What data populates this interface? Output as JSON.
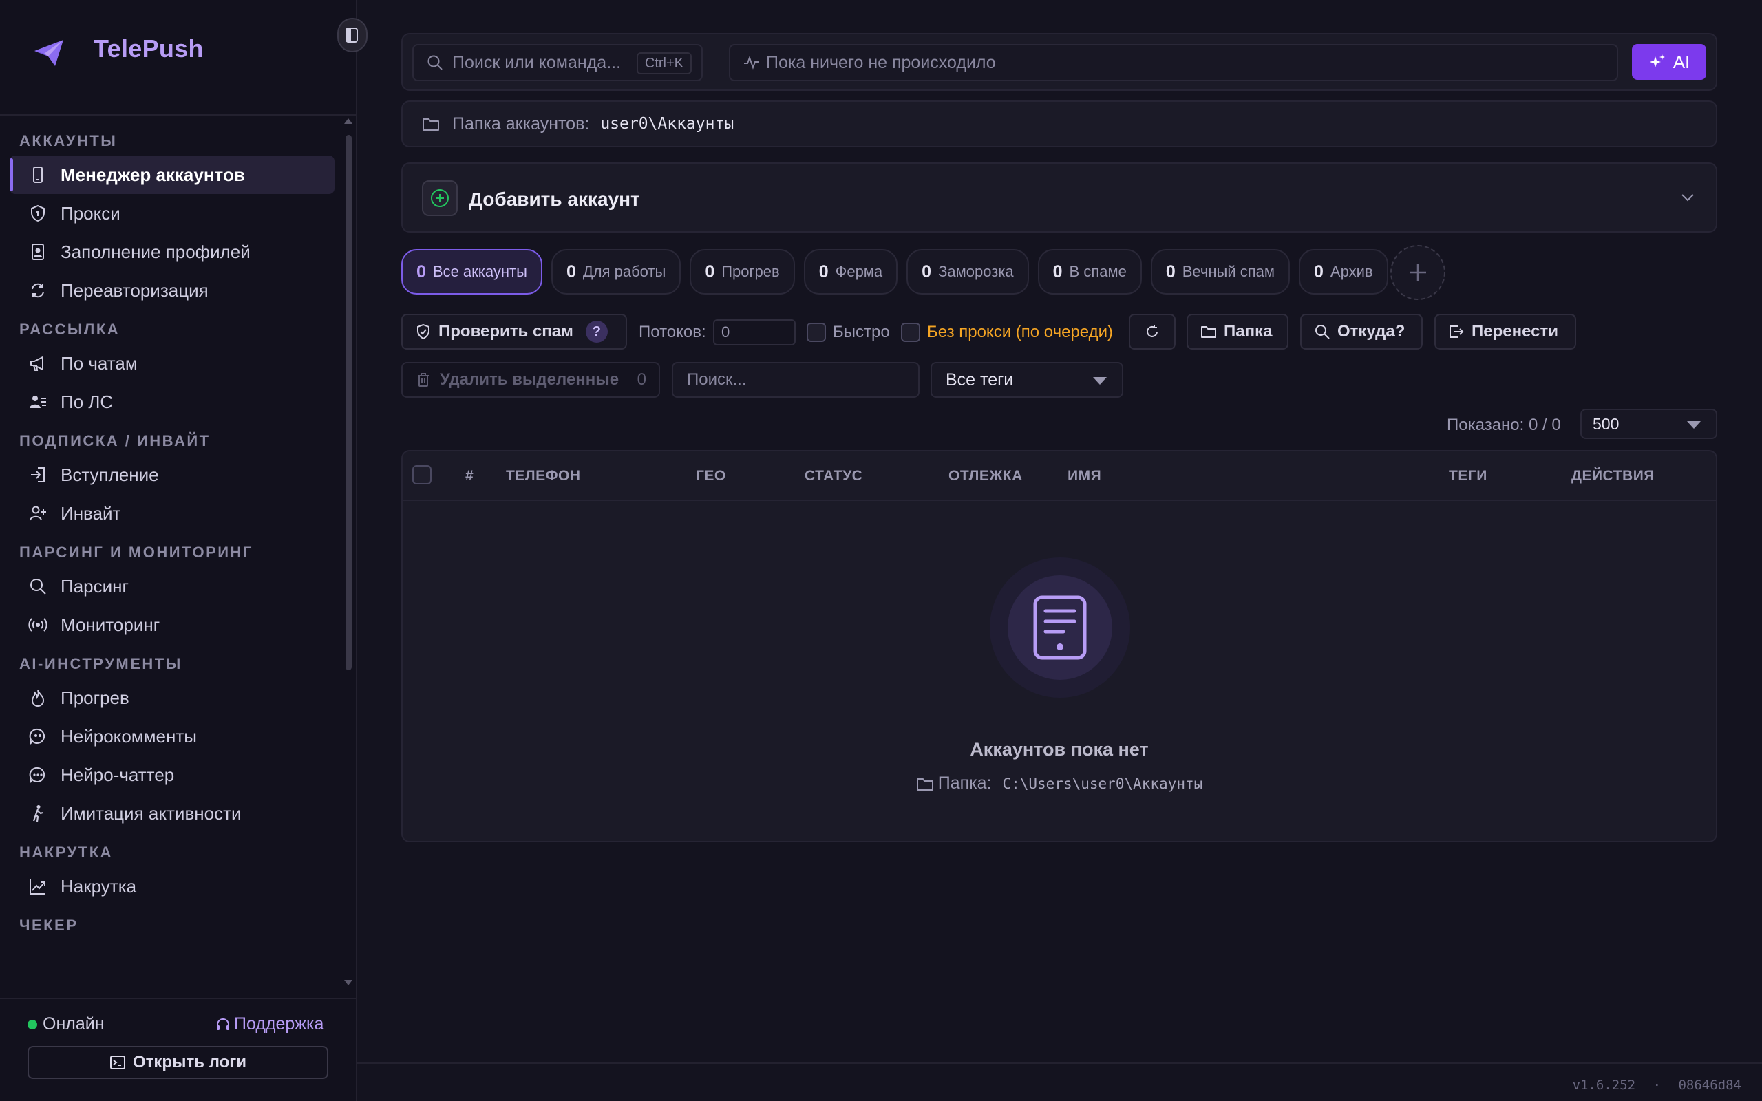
{
  "app": {
    "name": "TelePush"
  },
  "sidebar": {
    "sections": [
      {
        "title": "АККАУНТЫ",
        "items": [
          {
            "label": "Менеджер аккаунтов",
            "icon": "phone-icon",
            "active": true
          },
          {
            "label": "Прокси",
            "icon": "shield-icon"
          },
          {
            "label": "Заполнение профилей",
            "icon": "profile-card-icon"
          },
          {
            "label": "Переавторизация",
            "icon": "refresh-icon"
          }
        ]
      },
      {
        "title": "РАССЫЛКА",
        "items": [
          {
            "label": "По чатам",
            "icon": "megaphone-icon"
          },
          {
            "label": "По ЛС",
            "icon": "users-icon"
          }
        ]
      },
      {
        "title": "ПОДПИСКА / ИНВАЙТ",
        "items": [
          {
            "label": "Вступление",
            "icon": "login-icon"
          },
          {
            "label": "Инвайт",
            "icon": "user-plus-icon"
          }
        ]
      },
      {
        "title": "ПАРСИНГ И МОНИТОРИНГ",
        "items": [
          {
            "label": "Парсинг",
            "icon": "search-icon"
          },
          {
            "label": "Мониторинг",
            "icon": "radio-icon"
          }
        ]
      },
      {
        "title": "AI-ИНСТРУМЕНТЫ",
        "items": [
          {
            "label": "Прогрев",
            "icon": "flame-icon"
          },
          {
            "label": "Нейрокомменты",
            "icon": "quote-bubble-icon"
          },
          {
            "label": "Нейро-чаттер",
            "icon": "chat-dots-icon"
          },
          {
            "label": "Имитация активности",
            "icon": "walking-icon"
          }
        ]
      },
      {
        "title": "НАКРУТКА",
        "items": [
          {
            "label": "Накрутка",
            "icon": "chart-up-icon"
          }
        ]
      },
      {
        "title": "ЧЕКЕР",
        "items": []
      }
    ],
    "footer": {
      "status": "Онлайн",
      "support": "Поддержка",
      "logs_button": "Открыть логи"
    }
  },
  "topbar": {
    "search_placeholder": "Поиск или команда...",
    "shortcut": "Ctrl+K",
    "activity": "Пока ничего не происходило",
    "ai_button": "AI"
  },
  "folder": {
    "label": "Папка аккаунтов:",
    "path": "user0\\Аккаунты"
  },
  "add_account": {
    "title": "Добавить аккаунт"
  },
  "tabs": [
    {
      "count": "0",
      "label": "Все аккаунты",
      "active": true
    },
    {
      "count": "0",
      "label": "Для работы"
    },
    {
      "count": "0",
      "label": "Прогрев"
    },
    {
      "count": "0",
      "label": "Ферма"
    },
    {
      "count": "0",
      "label": "Заморозка"
    },
    {
      "count": "0",
      "label": "В спаме"
    },
    {
      "count": "0",
      "label": "Вечный спам"
    },
    {
      "count": "0",
      "label": "Архив"
    }
  ],
  "toolbar": {
    "check_spam": "Проверить спам",
    "help": "?",
    "threads_label": "Потоков:",
    "threads_value": "0",
    "fast_label": "Быстро",
    "no_proxy_label": "Без прокси (по очереди)",
    "folder_btn": "Папка",
    "where_btn": "Откуда?",
    "move_btn": "Перенести",
    "delete_selected": "Удалить выделенные",
    "delete_count": "0",
    "search_placeholder": "Поиск...",
    "tags_select": "Все теги",
    "shown": "Показано: 0 / 0",
    "page_size": "500"
  },
  "table": {
    "columns": [
      "#",
      "ТЕЛЕФОН",
      "ГЕО",
      "СТАТУС",
      "ОТЛЕЖКА",
      "ИМЯ",
      "ТЕГИ",
      "ДЕЙСТВИЯ"
    ],
    "rows": [],
    "empty_title": "Аккаунтов пока нет",
    "empty_folder_label": "Папка:",
    "empty_folder_path": "C:\\Users\\user0\\Аккаунты"
  },
  "statusbar": {
    "version": "v1.6.252",
    "separator": "·",
    "build": "08646d84"
  },
  "colors": {
    "accent": "#7c3aed",
    "accent_text": "#b79cf5",
    "online": "#22c55e",
    "warning": "#f5a524"
  }
}
